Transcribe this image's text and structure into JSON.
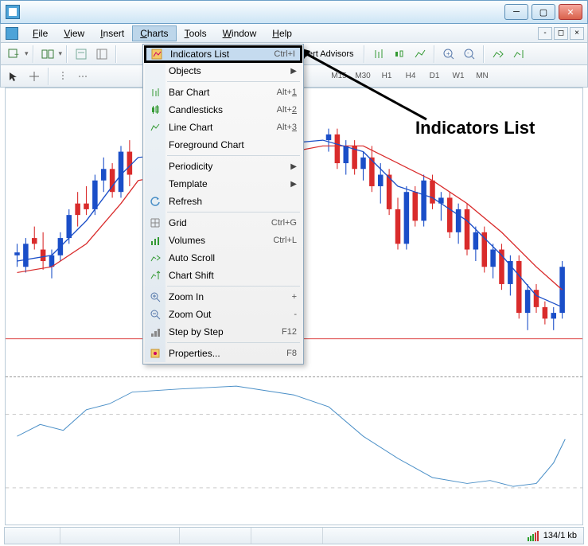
{
  "menubar": {
    "items": [
      "File",
      "View",
      "Insert",
      "Charts",
      "Tools",
      "Window",
      "Help"
    ],
    "active": "Charts"
  },
  "toolbar1": {
    "expert_advisors": "Expert Advisors"
  },
  "toolbar2": {
    "timeframes": [
      "M15",
      "M30",
      "H1",
      "H4",
      "D1",
      "W1",
      "MN"
    ]
  },
  "dropdown": {
    "items": [
      {
        "icon": "indicators-list-icon",
        "label": "Indicators List",
        "shortcut": "Ctrl+I",
        "highlight": true
      },
      {
        "label": "Objects",
        "arrow": true
      },
      {
        "sep": true
      },
      {
        "icon": "bar-chart-icon",
        "label": "Bar Chart",
        "shortcut": "Alt+1",
        "u": "1"
      },
      {
        "icon": "candlestick-icon",
        "label": "Candlesticks",
        "shortcut": "Alt+2",
        "u": "2"
      },
      {
        "icon": "line-chart-icon",
        "label": "Line Chart",
        "shortcut": "Alt+3",
        "u": "3"
      },
      {
        "label": "Foreground Chart"
      },
      {
        "sep": true
      },
      {
        "label": "Periodicity",
        "arrow": true
      },
      {
        "label": "Template",
        "arrow": true
      },
      {
        "icon": "refresh-icon",
        "label": "Refresh"
      },
      {
        "sep": true
      },
      {
        "icon": "grid-icon",
        "label": "Grid",
        "shortcut": "Ctrl+G"
      },
      {
        "icon": "volumes-icon",
        "label": "Volumes",
        "shortcut": "Ctrl+L"
      },
      {
        "icon": "autoscroll-icon",
        "label": "Auto Scroll"
      },
      {
        "icon": "chartshift-icon",
        "label": "Chart Shift"
      },
      {
        "sep": true
      },
      {
        "icon": "zoomin-icon",
        "label": "Zoom In",
        "shortcut": "+"
      },
      {
        "icon": "zoomout-icon",
        "label": "Zoom Out",
        "shortcut": "-"
      },
      {
        "icon": "step-icon",
        "label": "Step by Step",
        "shortcut": "F12"
      },
      {
        "sep": true
      },
      {
        "icon": "properties-icon",
        "label": "Properties...",
        "shortcut": "F8"
      }
    ]
  },
  "annotation": "Indicators List",
  "status": {
    "connection": "134/1 kb"
  },
  "chart_data": {
    "type": "candlestick",
    "title": "",
    "panels": 2,
    "main": {
      "series": [
        {
          "name": "price",
          "type": "candlestick",
          "colors": {
            "up": "#1a4ec8",
            "down": "#d92b2b"
          }
        },
        {
          "name": "ma_fast",
          "type": "line",
          "color": "#1a4ec8"
        },
        {
          "name": "ma_slow",
          "type": "line",
          "color": "#d92b2b"
        }
      ],
      "horizontal_levels": [
        {
          "y_pct": 87,
          "color": "#d92b2b"
        }
      ],
      "candles": [
        {
          "x": 0.02,
          "o": 0.57,
          "h": 0.54,
          "l": 0.62,
          "c": 0.58,
          "up": true
        },
        {
          "x": 0.035,
          "o": 0.62,
          "h": 0.52,
          "l": 0.64,
          "c": 0.54,
          "up": true
        },
        {
          "x": 0.05,
          "o": 0.54,
          "h": 0.48,
          "l": 0.56,
          "c": 0.52,
          "up": false
        },
        {
          "x": 0.065,
          "o": 0.56,
          "h": 0.5,
          "l": 0.63,
          "c": 0.6,
          "up": false
        },
        {
          "x": 0.08,
          "o": 0.62,
          "h": 0.56,
          "l": 0.66,
          "c": 0.58,
          "up": true
        },
        {
          "x": 0.095,
          "o": 0.58,
          "h": 0.5,
          "l": 0.6,
          "c": 0.52,
          "up": true
        },
        {
          "x": 0.11,
          "o": 0.52,
          "h": 0.42,
          "l": 0.54,
          "c": 0.44,
          "up": true
        },
        {
          "x": 0.125,
          "o": 0.44,
          "h": 0.36,
          "l": 0.48,
          "c": 0.4,
          "up": false
        },
        {
          "x": 0.14,
          "o": 0.4,
          "h": 0.34,
          "l": 0.44,
          "c": 0.42,
          "up": false
        },
        {
          "x": 0.155,
          "o": 0.42,
          "h": 0.3,
          "l": 0.44,
          "c": 0.32,
          "up": true
        },
        {
          "x": 0.17,
          "o": 0.32,
          "h": 0.24,
          "l": 0.36,
          "c": 0.28,
          "up": true
        },
        {
          "x": 0.185,
          "o": 0.28,
          "h": 0.26,
          "l": 0.38,
          "c": 0.36,
          "up": false
        },
        {
          "x": 0.2,
          "o": 0.36,
          "h": 0.2,
          "l": 0.38,
          "c": 0.22,
          "up": true
        },
        {
          "x": 0.215,
          "o": 0.22,
          "h": 0.18,
          "l": 0.34,
          "c": 0.3,
          "up": false
        },
        {
          "x": 0.56,
          "o": 0.18,
          "h": 0.14,
          "l": 0.22,
          "c": 0.16,
          "up": true
        },
        {
          "x": 0.575,
          "o": 0.16,
          "h": 0.14,
          "l": 0.28,
          "c": 0.26,
          "up": false
        },
        {
          "x": 0.59,
          "o": 0.26,
          "h": 0.18,
          "l": 0.3,
          "c": 0.2,
          "up": true
        },
        {
          "x": 0.605,
          "o": 0.2,
          "h": 0.18,
          "l": 0.3,
          "c": 0.28,
          "up": false
        },
        {
          "x": 0.62,
          "o": 0.28,
          "h": 0.22,
          "l": 0.32,
          "c": 0.24,
          "up": true
        },
        {
          "x": 0.635,
          "o": 0.24,
          "h": 0.2,
          "l": 0.36,
          "c": 0.34,
          "up": false
        },
        {
          "x": 0.65,
          "o": 0.34,
          "h": 0.26,
          "l": 0.4,
          "c": 0.3,
          "up": true
        },
        {
          "x": 0.665,
          "o": 0.3,
          "h": 0.28,
          "l": 0.44,
          "c": 0.42,
          "up": false
        },
        {
          "x": 0.68,
          "o": 0.42,
          "h": 0.38,
          "l": 0.56,
          "c": 0.54,
          "up": false
        },
        {
          "x": 0.695,
          "o": 0.54,
          "h": 0.34,
          "l": 0.56,
          "c": 0.36,
          "up": true
        },
        {
          "x": 0.71,
          "o": 0.36,
          "h": 0.34,
          "l": 0.48,
          "c": 0.46,
          "up": false
        },
        {
          "x": 0.725,
          "o": 0.46,
          "h": 0.3,
          "l": 0.48,
          "c": 0.32,
          "up": true
        },
        {
          "x": 0.74,
          "o": 0.32,
          "h": 0.3,
          "l": 0.42,
          "c": 0.4,
          "up": false
        },
        {
          "x": 0.755,
          "o": 0.4,
          "h": 0.36,
          "l": 0.46,
          "c": 0.38,
          "up": true
        },
        {
          "x": 0.77,
          "o": 0.38,
          "h": 0.36,
          "l": 0.52,
          "c": 0.5,
          "up": false
        },
        {
          "x": 0.785,
          "o": 0.5,
          "h": 0.4,
          "l": 0.54,
          "c": 0.42,
          "up": true
        },
        {
          "x": 0.8,
          "o": 0.42,
          "h": 0.4,
          "l": 0.58,
          "c": 0.56,
          "up": false
        },
        {
          "x": 0.815,
          "o": 0.56,
          "h": 0.48,
          "l": 0.6,
          "c": 0.5,
          "up": true
        },
        {
          "x": 0.83,
          "o": 0.5,
          "h": 0.48,
          "l": 0.64,
          "c": 0.62,
          "up": false
        },
        {
          "x": 0.845,
          "o": 0.62,
          "h": 0.54,
          "l": 0.66,
          "c": 0.56,
          "up": true
        },
        {
          "x": 0.86,
          "o": 0.56,
          "h": 0.54,
          "l": 0.7,
          "c": 0.68,
          "up": false
        },
        {
          "x": 0.875,
          "o": 0.68,
          "h": 0.58,
          "l": 0.72,
          "c": 0.6,
          "up": true
        },
        {
          "x": 0.89,
          "o": 0.6,
          "h": 0.58,
          "l": 0.8,
          "c": 0.78,
          "up": false
        },
        {
          "x": 0.905,
          "o": 0.78,
          "h": 0.68,
          "l": 0.84,
          "c": 0.7,
          "up": true
        },
        {
          "x": 0.92,
          "o": 0.7,
          "h": 0.68,
          "l": 0.78,
          "c": 0.76,
          "up": false
        },
        {
          "x": 0.935,
          "o": 0.76,
          "h": 0.74,
          "l": 0.82,
          "c": 0.8,
          "up": false
        },
        {
          "x": 0.95,
          "o": 0.8,
          "h": 0.76,
          "l": 0.84,
          "c": 0.78,
          "up": true
        },
        {
          "x": 0.965,
          "o": 0.78,
          "h": 0.6,
          "l": 0.8,
          "c": 0.62,
          "up": true
        }
      ],
      "ma_fast_points": [
        [
          0.02,
          0.6
        ],
        [
          0.08,
          0.58
        ],
        [
          0.14,
          0.46
        ],
        [
          0.2,
          0.3
        ],
        [
          0.23,
          0.24
        ],
        [
          0.55,
          0.18
        ],
        [
          0.62,
          0.22
        ],
        [
          0.68,
          0.34
        ],
        [
          0.74,
          0.38
        ],
        [
          0.8,
          0.46
        ],
        [
          0.86,
          0.58
        ],
        [
          0.92,
          0.72
        ],
        [
          0.965,
          0.76
        ]
      ],
      "ma_slow_points": [
        [
          0.02,
          0.64
        ],
        [
          0.08,
          0.62
        ],
        [
          0.14,
          0.54
        ],
        [
          0.2,
          0.4
        ],
        [
          0.23,
          0.32
        ],
        [
          0.55,
          0.2
        ],
        [
          0.62,
          0.2
        ],
        [
          0.68,
          0.26
        ],
        [
          0.74,
          0.32
        ],
        [
          0.8,
          0.4
        ],
        [
          0.86,
          0.5
        ],
        [
          0.92,
          0.62
        ],
        [
          0.965,
          0.7
        ]
      ]
    },
    "sub": {
      "series": [
        {
          "name": "indicator",
          "type": "line",
          "color": "#4a8fc7"
        }
      ],
      "horizontal_levels": [
        {
          "y_pct": 25
        },
        {
          "y_pct": 75
        }
      ],
      "points": [
        [
          0.02,
          0.4
        ],
        [
          0.06,
          0.32
        ],
        [
          0.1,
          0.36
        ],
        [
          0.14,
          0.22
        ],
        [
          0.18,
          0.18
        ],
        [
          0.22,
          0.1
        ],
        [
          0.3,
          0.08
        ],
        [
          0.4,
          0.06
        ],
        [
          0.5,
          0.12
        ],
        [
          0.56,
          0.2
        ],
        [
          0.62,
          0.4
        ],
        [
          0.68,
          0.55
        ],
        [
          0.74,
          0.68
        ],
        [
          0.8,
          0.72
        ],
        [
          0.84,
          0.7
        ],
        [
          0.88,
          0.74
        ],
        [
          0.92,
          0.72
        ],
        [
          0.95,
          0.58
        ],
        [
          0.97,
          0.42
        ]
      ]
    }
  }
}
